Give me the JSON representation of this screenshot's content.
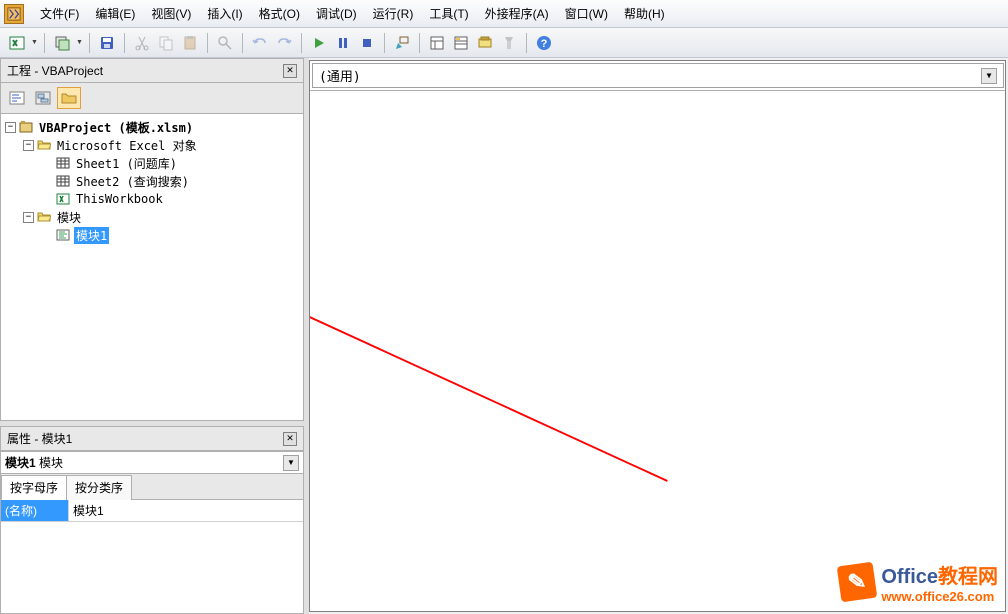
{
  "menus": [
    "文件(F)",
    "编辑(E)",
    "视图(V)",
    "插入(I)",
    "格式(O)",
    "调试(D)",
    "运行(R)",
    "工具(T)",
    "外接程序(A)",
    "窗口(W)",
    "帮助(H)"
  ],
  "project_panel": {
    "title": "工程 - VBAProject"
  },
  "tree": {
    "root": "VBAProject (模板.xlsm)",
    "excel_objects": "Microsoft Excel 对象",
    "sheet1": "Sheet1 (问题库)",
    "sheet2": "Sheet2 (查询搜索)",
    "workbook": "ThisWorkbook",
    "modules": "模块",
    "module1": "模块1"
  },
  "props_panel": {
    "title": "属性 - 模块1",
    "dropdown_name": "模块1",
    "dropdown_type": "模块",
    "tab1": "按字母序",
    "tab2": "按分类序",
    "prop_name": "(名称)",
    "prop_value": "模块1"
  },
  "code_panel": {
    "left_dd": "(通用)"
  },
  "watermark": {
    "brand1": "Office",
    "brand2": "教程网",
    "url": "www.office26.com"
  }
}
